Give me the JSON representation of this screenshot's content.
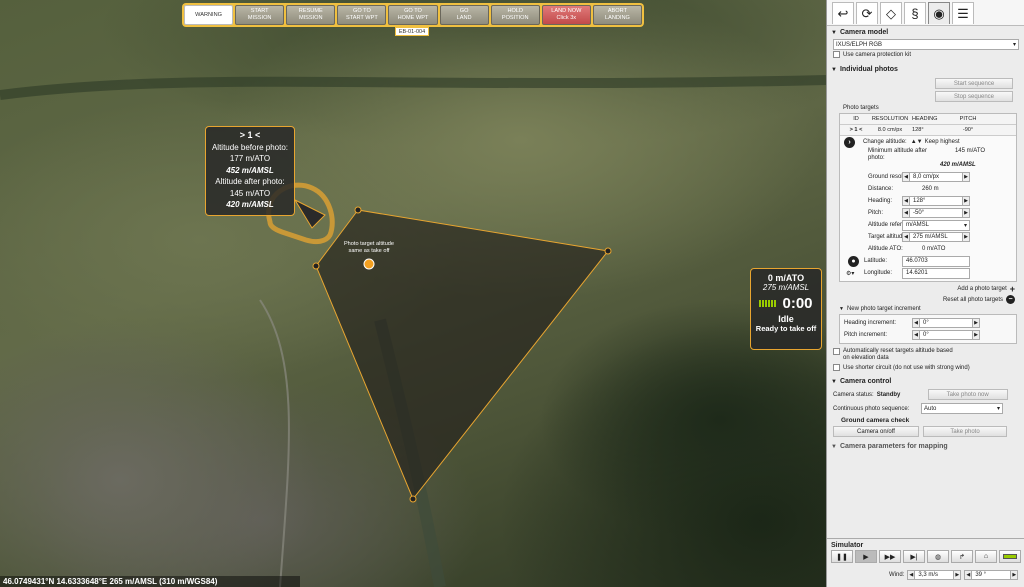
{
  "toolbar": {
    "buttons": [
      {
        "label": "WARNING"
      },
      {
        "label": "START\nMISSION"
      },
      {
        "label": "RESUME\nMISSION"
      },
      {
        "label": "GO TO\nSTART WPT"
      },
      {
        "label": "GO TO\nHOME WPT"
      },
      {
        "label": "GO\nLAND"
      },
      {
        "label": "HOLD\nPOSITION"
      },
      {
        "label": "LAND NOW\nClick 3x"
      },
      {
        "label": "ABORT\nLANDING"
      }
    ],
    "waypoint_tag": "EB-01-004"
  },
  "target_bubble": {
    "title": "> 1 <",
    "alt_before_label": "Altitude before photo:",
    "alt_before_ato": "177 m/ATO",
    "alt_before_amsl": "452 m/AMSL",
    "alt_after_label": "Altitude after photo:",
    "alt_after_ato": "145 m/ATO",
    "alt_after_amsl": "420 m/AMSL"
  },
  "map_label": "Photo target altitude same as take off",
  "status": {
    "altitude_ato": "0 m/ATO",
    "altitude_amsl": "275 m/AMSL",
    "timer": "0:00",
    "state": "Idle",
    "ready": "Ready to take off",
    "battery_level": 1.0
  },
  "coordinates": "46.0749431°N 14.6333648°E 265 m/AMSL (310 m/WGS84)",
  "panel": {
    "tabs": [
      "route-icon",
      "refresh-icon",
      "square-icon",
      "spring-icon",
      "camera-icon",
      "sliders-icon"
    ],
    "active_tab": 4,
    "camera_model": {
      "title": "Camera model",
      "value": "IXUS/ELPH RGB",
      "protection_label": "Use camera protection kit"
    },
    "individual": {
      "title": "Individual photos",
      "start_seq": "Start sequence",
      "stop_seq": "Stop sequence",
      "targets_label": "Photo targets",
      "headers": [
        "ID",
        "RESOLUTION",
        "HEADING",
        "PITCH"
      ],
      "row": {
        "id": "> 1 <",
        "resolution": "8.0 cm/px",
        "heading": "128°",
        "pitch": "-90°"
      },
      "change_altitude": "Change altitude:",
      "keep_highest": "Keep highest",
      "min_alt_label": "Minimum altitude after photo:",
      "min_alt_ato": "145 m/ATO",
      "min_alt_amsl": "420 m/AMSL",
      "ground_res_label": "Ground resolution:",
      "ground_res": "8,0 cm/px",
      "distance_label": "Distance:",
      "distance": "260 m",
      "heading_label": "Heading:",
      "heading": "128°",
      "pitch_label": "Pitch:",
      "pitch": "-50°",
      "alt_ref_label": "Altitude reference:",
      "alt_ref": "m/AMSL",
      "target_alt_label": "Target altitude:",
      "target_alt": "275 m/AMSL",
      "alt_ato_label": "Altitude ATO:",
      "alt_ato": "0 m/ATO",
      "lat_label": "Latitude:",
      "lat": "46.0703",
      "lon_label": "Longitude:",
      "lon": "14.6201",
      "add_target": "Add a photo target",
      "reset_targets": "Reset all photo targets",
      "new_increment": "New photo target increment",
      "heading_inc_label": "Heading increment:",
      "heading_inc": "0°",
      "pitch_inc_label": "Pitch increment:",
      "pitch_inc": "0°",
      "auto_reset": "Automatically reset targets altitude based on elevation data",
      "shorter_circuit": "Use shorter circuit (do not use with strong wind)"
    },
    "camera_control": {
      "title": "Camera control",
      "status_label": "Camera status:",
      "status": "Standby",
      "take_photo_now": "Take photo now",
      "continuous_label": "Continuous photo sequence:",
      "continuous": "Auto",
      "ground_check": "Ground camera check",
      "camera_onoff": "Camera on/off",
      "take_photo": "Take photo"
    },
    "footer_cut": "Camera parameters for mapping",
    "simulator": {
      "title": "Simulator",
      "wind_label": "Wind:",
      "wind_speed": "3,3 m/s",
      "wind_dir": "39 °"
    }
  }
}
